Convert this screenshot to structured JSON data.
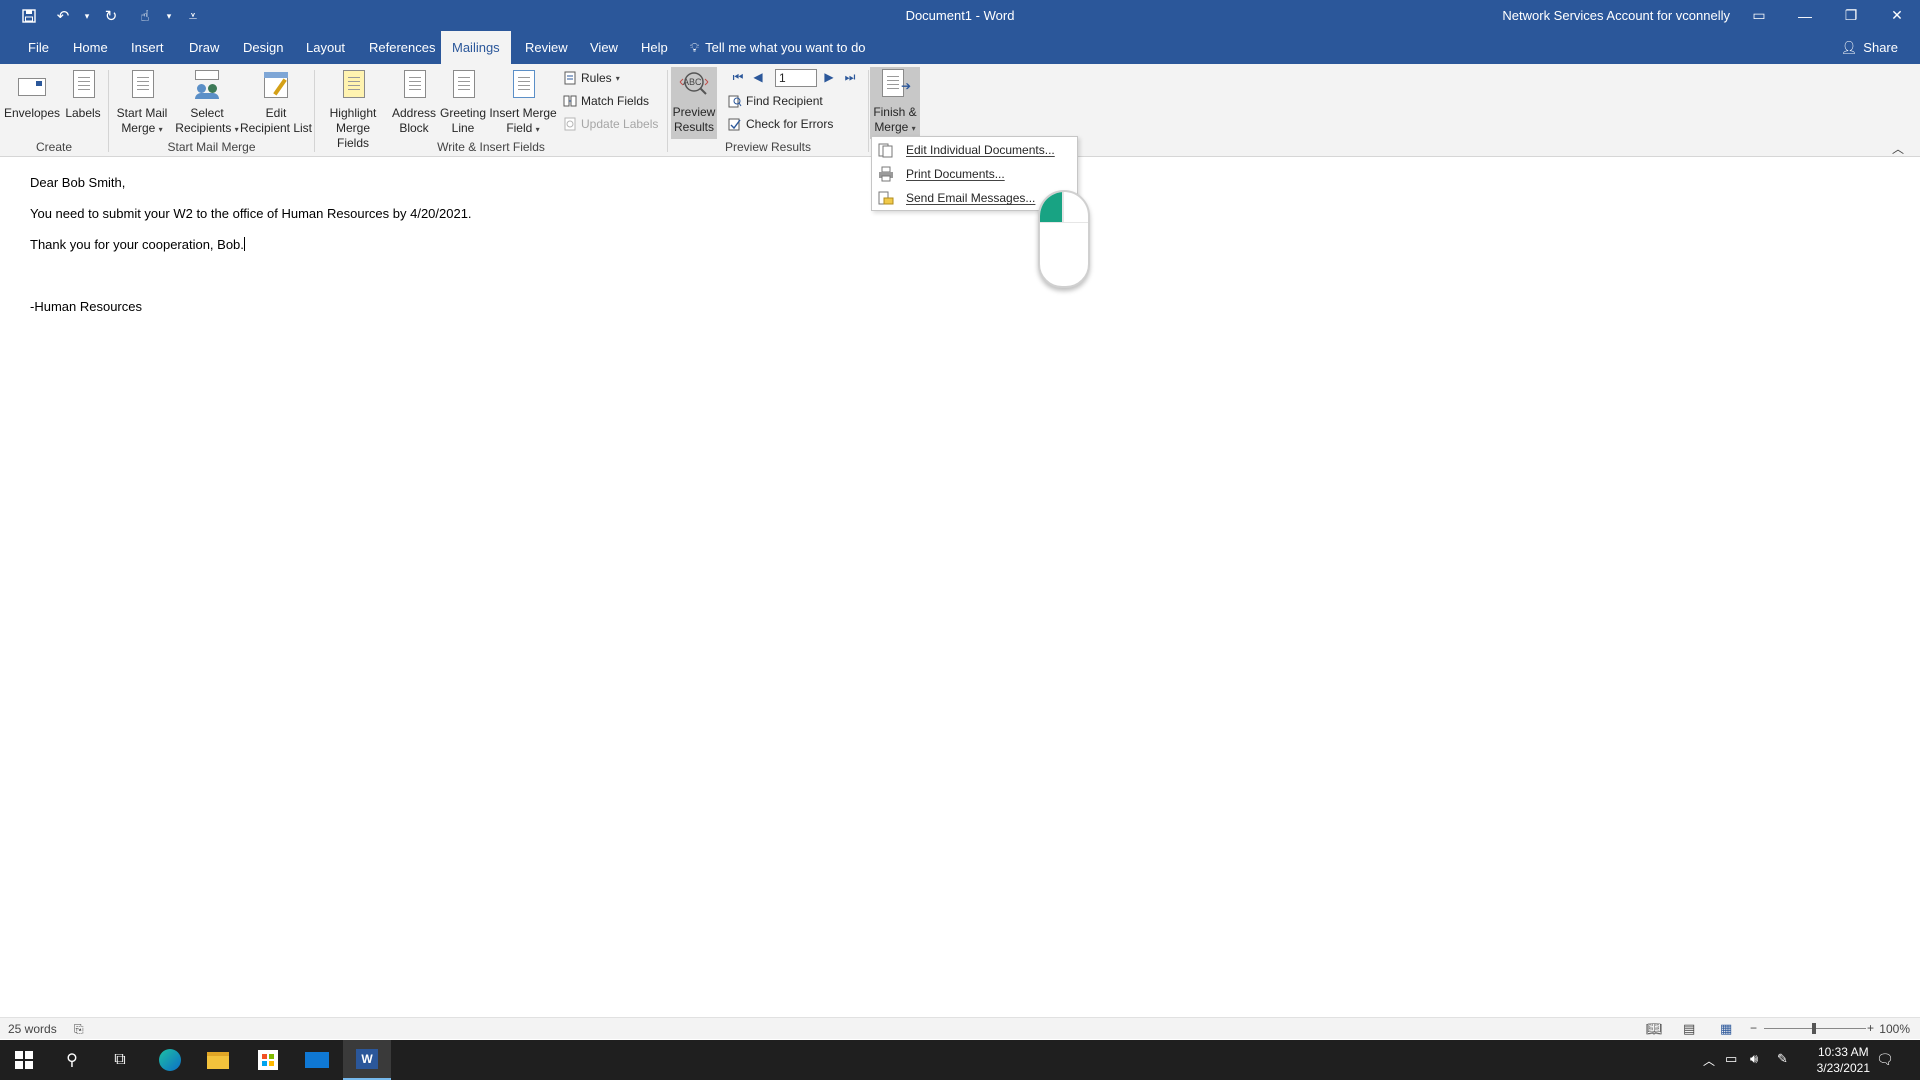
{
  "titlebar": {
    "doc_title": "Document1 - Word",
    "account": "Network Services Account for vconnelly"
  },
  "tabs": [
    "File",
    "Home",
    "Insert",
    "Draw",
    "Design",
    "Layout",
    "References",
    "Mailings",
    "Review",
    "View",
    "Help"
  ],
  "active_tab": "Mailings",
  "tellme": "Tell me what you want to do",
  "share": "Share",
  "ribbon": {
    "create": {
      "label": "Create",
      "envelopes": "Envelopes",
      "labels": "Labels"
    },
    "start_mail_merge": {
      "label": "Start Mail Merge",
      "start_l1": "Start Mail",
      "start_l2": "Merge",
      "select_l1": "Select",
      "select_l2": "Recipients",
      "edit_l1": "Edit",
      "edit_l2": "Recipient List"
    },
    "write_insert": {
      "label": "Write & Insert Fields",
      "highlight_l1": "Highlight",
      "highlight_l2": "Merge Fields",
      "address_l1": "Address",
      "address_l2": "Block",
      "greeting_l1": "Greeting",
      "greeting_l2": "Line",
      "insert_l1": "Insert Merge",
      "insert_l2": "Field",
      "rules": "Rules",
      "match_fields": "Match Fields",
      "update_labels": "Update Labels"
    },
    "preview": {
      "label": "Preview Results",
      "preview_l1": "Preview",
      "preview_l2": "Results",
      "record": "1",
      "find_recipient": "Find Recipient",
      "check_errors": "Check for Errors"
    },
    "finish": {
      "finish_l1": "Finish &",
      "finish_l2": "Merge"
    }
  },
  "finish_menu": [
    "Edit Individual Documents...",
    "Print Documents...",
    "Send Email Messages..."
  ],
  "document": {
    "lines": [
      "Dear Bob Smith,",
      "You need to submit your W2 to the office of Human Resources by 4/20/2021.",
      "Thank you for your cooperation, Bob.",
      "-Human Resources"
    ]
  },
  "status": {
    "word_count": "25 words",
    "zoom": "100%"
  },
  "taskbar": {
    "time": "10:33 AM",
    "date": "3/23/2021"
  },
  "colors": {
    "accent": "#2b579a",
    "ribbon_bg": "#f3f3f3",
    "mouse_highlight": "#18a383"
  }
}
